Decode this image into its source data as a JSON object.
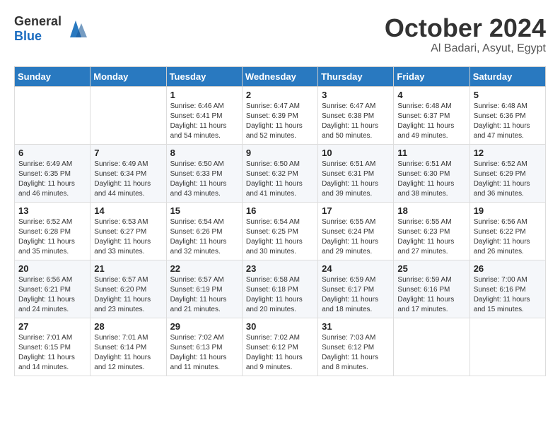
{
  "header": {
    "logo_general": "General",
    "logo_blue": "Blue",
    "month_title": "October 2024",
    "location": "Al Badari, Asyut, Egypt"
  },
  "days_of_week": [
    "Sunday",
    "Monday",
    "Tuesday",
    "Wednesday",
    "Thursday",
    "Friday",
    "Saturday"
  ],
  "weeks": [
    [
      {
        "day": "",
        "info": ""
      },
      {
        "day": "",
        "info": ""
      },
      {
        "day": "1",
        "info": "Sunrise: 6:46 AM\nSunset: 6:41 PM\nDaylight: 11 hours and 54 minutes."
      },
      {
        "day": "2",
        "info": "Sunrise: 6:47 AM\nSunset: 6:39 PM\nDaylight: 11 hours and 52 minutes."
      },
      {
        "day": "3",
        "info": "Sunrise: 6:47 AM\nSunset: 6:38 PM\nDaylight: 11 hours and 50 minutes."
      },
      {
        "day": "4",
        "info": "Sunrise: 6:48 AM\nSunset: 6:37 PM\nDaylight: 11 hours and 49 minutes."
      },
      {
        "day": "5",
        "info": "Sunrise: 6:48 AM\nSunset: 6:36 PM\nDaylight: 11 hours and 47 minutes."
      }
    ],
    [
      {
        "day": "6",
        "info": "Sunrise: 6:49 AM\nSunset: 6:35 PM\nDaylight: 11 hours and 46 minutes."
      },
      {
        "day": "7",
        "info": "Sunrise: 6:49 AM\nSunset: 6:34 PM\nDaylight: 11 hours and 44 minutes."
      },
      {
        "day": "8",
        "info": "Sunrise: 6:50 AM\nSunset: 6:33 PM\nDaylight: 11 hours and 43 minutes."
      },
      {
        "day": "9",
        "info": "Sunrise: 6:50 AM\nSunset: 6:32 PM\nDaylight: 11 hours and 41 minutes."
      },
      {
        "day": "10",
        "info": "Sunrise: 6:51 AM\nSunset: 6:31 PM\nDaylight: 11 hours and 39 minutes."
      },
      {
        "day": "11",
        "info": "Sunrise: 6:51 AM\nSunset: 6:30 PM\nDaylight: 11 hours and 38 minutes."
      },
      {
        "day": "12",
        "info": "Sunrise: 6:52 AM\nSunset: 6:29 PM\nDaylight: 11 hours and 36 minutes."
      }
    ],
    [
      {
        "day": "13",
        "info": "Sunrise: 6:52 AM\nSunset: 6:28 PM\nDaylight: 11 hours and 35 minutes."
      },
      {
        "day": "14",
        "info": "Sunrise: 6:53 AM\nSunset: 6:27 PM\nDaylight: 11 hours and 33 minutes."
      },
      {
        "day": "15",
        "info": "Sunrise: 6:54 AM\nSunset: 6:26 PM\nDaylight: 11 hours and 32 minutes."
      },
      {
        "day": "16",
        "info": "Sunrise: 6:54 AM\nSunset: 6:25 PM\nDaylight: 11 hours and 30 minutes."
      },
      {
        "day": "17",
        "info": "Sunrise: 6:55 AM\nSunset: 6:24 PM\nDaylight: 11 hours and 29 minutes."
      },
      {
        "day": "18",
        "info": "Sunrise: 6:55 AM\nSunset: 6:23 PM\nDaylight: 11 hours and 27 minutes."
      },
      {
        "day": "19",
        "info": "Sunrise: 6:56 AM\nSunset: 6:22 PM\nDaylight: 11 hours and 26 minutes."
      }
    ],
    [
      {
        "day": "20",
        "info": "Sunrise: 6:56 AM\nSunset: 6:21 PM\nDaylight: 11 hours and 24 minutes."
      },
      {
        "day": "21",
        "info": "Sunrise: 6:57 AM\nSunset: 6:20 PM\nDaylight: 11 hours and 23 minutes."
      },
      {
        "day": "22",
        "info": "Sunrise: 6:57 AM\nSunset: 6:19 PM\nDaylight: 11 hours and 21 minutes."
      },
      {
        "day": "23",
        "info": "Sunrise: 6:58 AM\nSunset: 6:18 PM\nDaylight: 11 hours and 20 minutes."
      },
      {
        "day": "24",
        "info": "Sunrise: 6:59 AM\nSunset: 6:17 PM\nDaylight: 11 hours and 18 minutes."
      },
      {
        "day": "25",
        "info": "Sunrise: 6:59 AM\nSunset: 6:16 PM\nDaylight: 11 hours and 17 minutes."
      },
      {
        "day": "26",
        "info": "Sunrise: 7:00 AM\nSunset: 6:16 PM\nDaylight: 11 hours and 15 minutes."
      }
    ],
    [
      {
        "day": "27",
        "info": "Sunrise: 7:01 AM\nSunset: 6:15 PM\nDaylight: 11 hours and 14 minutes."
      },
      {
        "day": "28",
        "info": "Sunrise: 7:01 AM\nSunset: 6:14 PM\nDaylight: 11 hours and 12 minutes."
      },
      {
        "day": "29",
        "info": "Sunrise: 7:02 AM\nSunset: 6:13 PM\nDaylight: 11 hours and 11 minutes."
      },
      {
        "day": "30",
        "info": "Sunrise: 7:02 AM\nSunset: 6:12 PM\nDaylight: 11 hours and 9 minutes."
      },
      {
        "day": "31",
        "info": "Sunrise: 7:03 AM\nSunset: 6:12 PM\nDaylight: 11 hours and 8 minutes."
      },
      {
        "day": "",
        "info": ""
      },
      {
        "day": "",
        "info": ""
      }
    ]
  ]
}
